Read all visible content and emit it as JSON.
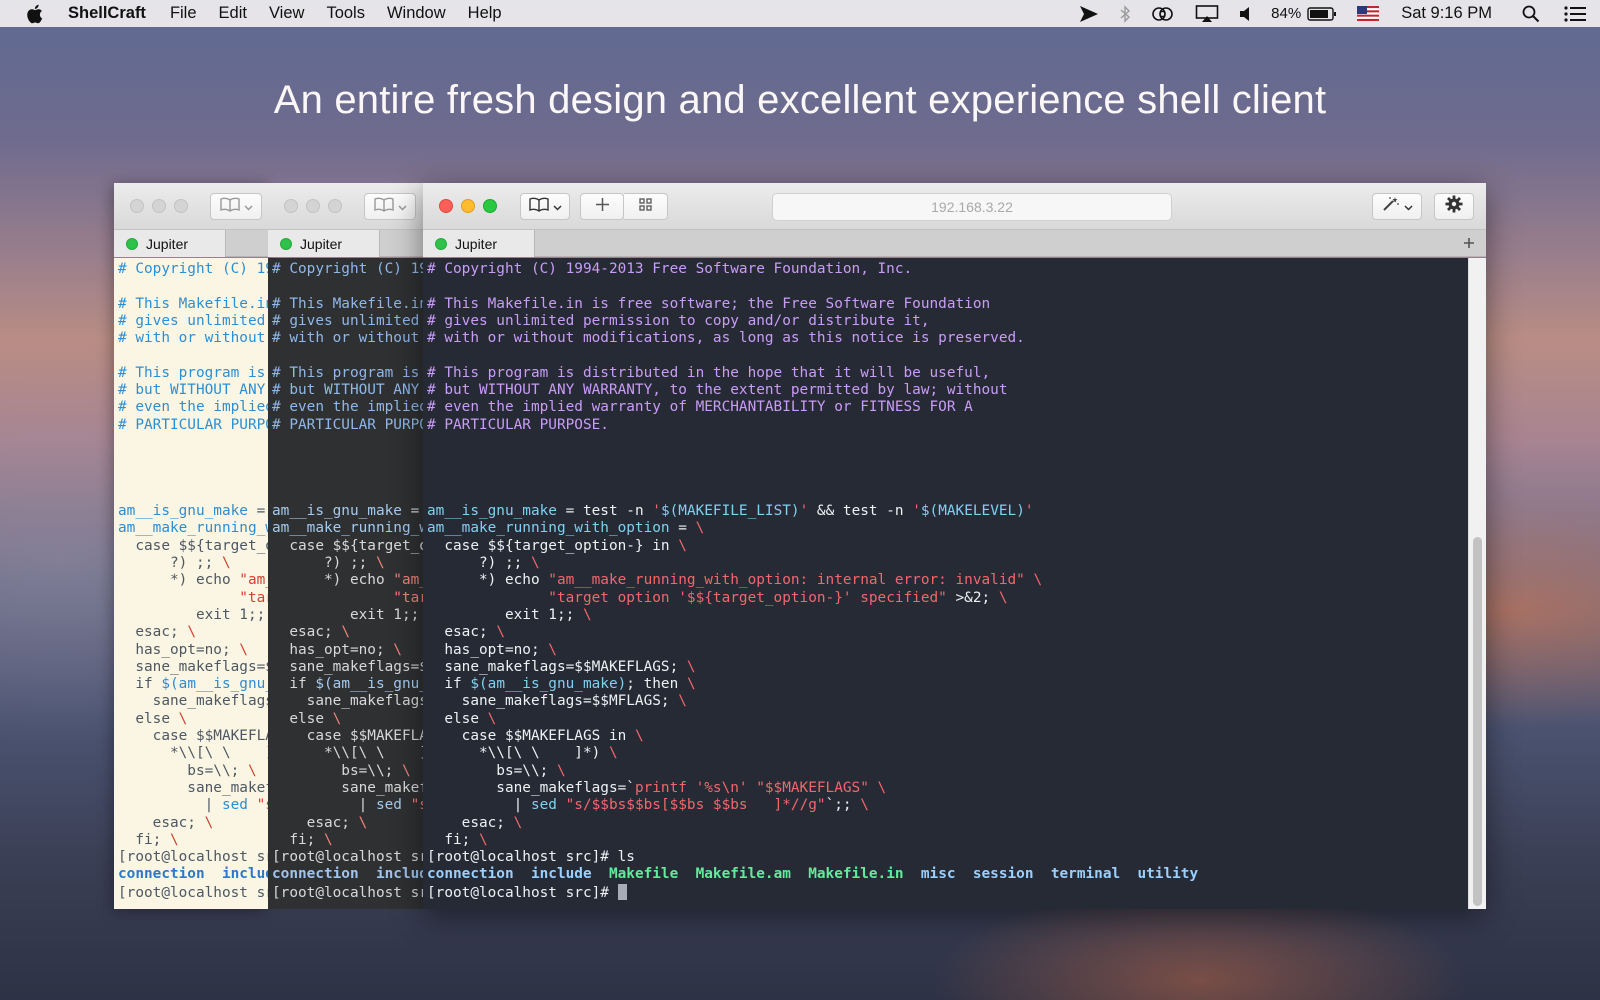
{
  "menubar": {
    "app_name": "ShellCraft",
    "items": [
      "File",
      "Edit",
      "View",
      "Tools",
      "Window",
      "Help"
    ],
    "status_icons": [
      "location-arrow-icon",
      "bluetooth-icon",
      "creative-cloud-icon",
      "airplay-icon",
      "volume-icon"
    ],
    "battery": "84%",
    "flag_icon": "us-flag-icon",
    "clock": "Sat 9:16 PM",
    "right_icons": [
      "spotlight-icon",
      "notification-center-icon"
    ]
  },
  "headline": "An entire fresh design and excellent experience shell client",
  "windows": {
    "address": "192.168.3.22",
    "tab_label": "Jupiter",
    "toolbar_icons": [
      "bookmarks-icon",
      "new-tab-plus-icon",
      "grid-icon",
      "magic-wand-icon",
      "gear-icon"
    ]
  },
  "terminal": {
    "lines": [
      [
        [
          "cm",
          "# Copyright (C) 1994-2013 Free Software Foundation, Inc."
        ]
      ],
      [],
      [
        [
          "cm",
          "# This Makefile.in is free software; the Free Software Foundation"
        ]
      ],
      [
        [
          "cm",
          "# gives unlimited permission to copy and/or distribute it,"
        ]
      ],
      [
        [
          "cm",
          "# with or without modifications, as long as this notice is preserved."
        ]
      ],
      [],
      [
        [
          "cm",
          "# This program is distributed in the hope that it will be useful,"
        ]
      ],
      [
        [
          "cm",
          "# but WITHOUT ANY WARRANTY, to the extent permitted by law; without"
        ]
      ],
      [
        [
          "cm",
          "# even the implied warranty of MERCHANTABILITY or FITNESS FOR A"
        ]
      ],
      [
        [
          "cm",
          "# PARTICULAR PURPOSE."
        ]
      ],
      [],
      [],
      [],
      [],
      [
        [
          "fn",
          "am__is_gnu_make"
        ],
        [
          "",
          " = test -n "
        ],
        [
          "st",
          "'"
        ],
        [
          "fn",
          "$(MAKEFILE_LIST)"
        ],
        [
          "st",
          "'"
        ],
        [
          "",
          " && test -n "
        ],
        [
          "st",
          "'"
        ],
        [
          "fn",
          "$(MAKELEVEL)"
        ],
        [
          "st",
          "'"
        ]
      ],
      [
        [
          "fn",
          "am__make_running_with_option"
        ],
        [
          "",
          " = "
        ],
        [
          "st",
          "\\"
        ]
      ],
      [
        [
          "",
          "  case $${target_option-} in "
        ],
        [
          "st",
          "\\"
        ]
      ],
      [
        [
          "",
          "      ?) ;; "
        ],
        [
          "st",
          "\\"
        ]
      ],
      [
        [
          "",
          "      *) echo "
        ],
        [
          "st",
          "\"am__make_running_with_option: internal error: invalid\""
        ],
        [
          "",
          " "
        ],
        [
          "st",
          "\\"
        ]
      ],
      [
        [
          "",
          "              "
        ],
        [
          "st",
          "\"target option '$${target_option-}' specified\""
        ],
        [
          "",
          " >&2; "
        ],
        [
          "st",
          "\\"
        ]
      ],
      [
        [
          "",
          "         exit 1;; "
        ],
        [
          "st",
          "\\"
        ]
      ],
      [
        [
          "",
          "  esac; "
        ],
        [
          "st",
          "\\"
        ]
      ],
      [
        [
          "",
          "  has_opt=no; "
        ],
        [
          "st",
          "\\"
        ]
      ],
      [
        [
          "",
          "  sane_makeflags=$$MAKEFLAGS; "
        ],
        [
          "st",
          "\\"
        ]
      ],
      [
        [
          "",
          "  if "
        ],
        [
          "fn",
          "$(am__is_gnu_make)"
        ],
        [
          "",
          "; then "
        ],
        [
          "st",
          "\\"
        ]
      ],
      [
        [
          "",
          "    sane_makeflags=$$MFLAGS; "
        ],
        [
          "st",
          "\\"
        ]
      ],
      [
        [
          "",
          "  else "
        ],
        [
          "st",
          "\\"
        ]
      ],
      [
        [
          "",
          "    case $$MAKEFLAGS in "
        ],
        [
          "st",
          "\\"
        ]
      ],
      [
        [
          "",
          "      *\\\\[\\ \\    ]*) "
        ],
        [
          "st",
          "\\"
        ]
      ],
      [
        [
          "",
          "        bs=\\\\; "
        ],
        [
          "st",
          "\\"
        ]
      ],
      [
        [
          "",
          "        sane_makeflags=`"
        ],
        [
          "st",
          "printf '%s\\n' \"$$MAKEFLAGS\""
        ],
        [
          "",
          " "
        ],
        [
          "st",
          "\\"
        ]
      ],
      [
        [
          "",
          "          | "
        ],
        [
          "fn",
          "sed"
        ],
        [
          "",
          " "
        ],
        [
          "st",
          "\"s/$$bs$$bs[$$bs $$bs   ]*//g\""
        ],
        [
          "",
          "`;; "
        ],
        [
          "st",
          "\\"
        ]
      ],
      [
        [
          "",
          "    esac; "
        ],
        [
          "st",
          "\\"
        ]
      ],
      [
        [
          "",
          "  fi; "
        ],
        [
          "st",
          "\\"
        ]
      ],
      [
        [
          "",
          "[root@localhost src]# ls"
        ]
      ],
      [
        [
          "ls",
          "connection"
        ],
        [
          "",
          "  "
        ],
        [
          "ls",
          "include"
        ],
        [
          "",
          "  "
        ],
        [
          "lg",
          "Makefile"
        ],
        [
          "",
          "  "
        ],
        [
          "lg",
          "Makefile.am"
        ],
        [
          "",
          "  "
        ],
        [
          "lg",
          "Makefile.in"
        ],
        [
          "",
          "  "
        ],
        [
          "ls",
          "misc"
        ],
        [
          "",
          "  "
        ],
        [
          "ls",
          "session"
        ],
        [
          "",
          "  "
        ],
        [
          "ls",
          "terminal"
        ],
        [
          "",
          "  "
        ],
        [
          "ls",
          "utility"
        ]
      ],
      [
        [
          "",
          "[root@localhost src]# "
        ],
        [
          "cursor",
          ""
        ]
      ]
    ]
  }
}
